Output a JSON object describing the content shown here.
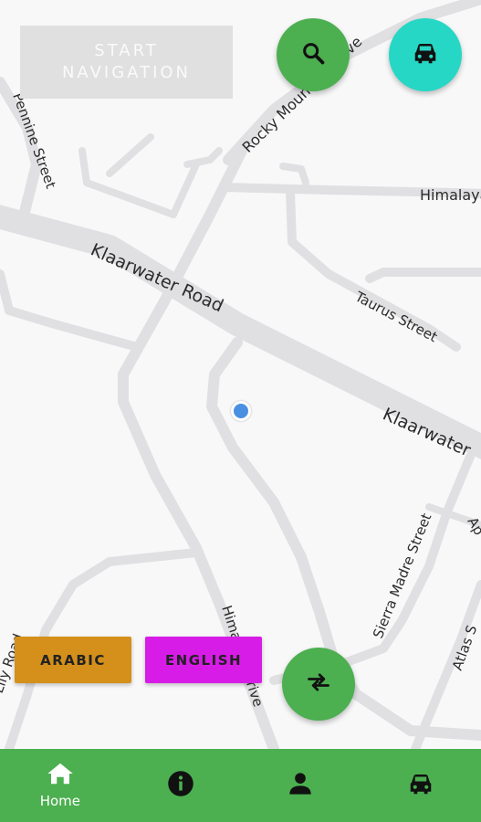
{
  "header": {
    "start_navigation_label": "START\nNAVIGATION"
  },
  "fabs": {
    "search_icon": "search-icon",
    "car_icon": "car-icon",
    "swap_icon": "swap-icon"
  },
  "map": {
    "roads": {
      "rocky": "Rocky Mountain Drive",
      "pennine": "Pennine Street",
      "himalaya_top": "Himalaya",
      "klaar1": "Klaarwater Road",
      "taurus": "Taurus Street",
      "klaar2": "Klaarwater",
      "sierra": "Sierra Madre Street",
      "ap": "Ap",
      "himalaya_bottom": "Himalaya Drive",
      "lily": "Lily Road",
      "atlas": "Atlas S"
    }
  },
  "language": {
    "arabic_label": "ARABIC",
    "english_label": "ENGLISH"
  },
  "bottom_nav": {
    "home_label": "Home",
    "items": [
      "home-icon",
      "info-icon",
      "person-icon",
      "car-icon"
    ]
  },
  "colors": {
    "green": "#4caf50",
    "teal": "#26d7c5",
    "arabic_bg": "#d4901a",
    "english_bg": "#d81ce8",
    "location_dot": "#4a90e2",
    "road": "#e0e0e3"
  }
}
